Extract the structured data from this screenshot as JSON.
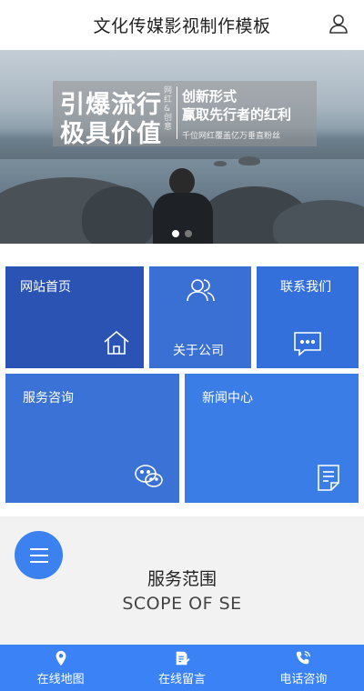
{
  "header": {
    "title": "文化传媒影视制作模板",
    "user_icon": "user-icon"
  },
  "banner": {
    "slogan_line1": "引爆流行",
    "slogan_line2": "极具价值",
    "slogan_vertical": "网红&创意",
    "right_line1": "创新形式",
    "right_line2": "赢取先行者的红利",
    "right_small": "千位网红覆盖亿万垂直粉丝",
    "slide_count": 2,
    "active_slide": 1
  },
  "tiles": [
    {
      "label": "网站首页",
      "icon": "home-icon"
    },
    {
      "label": "关于公司",
      "icon": "users-icon"
    },
    {
      "label": "联系我们",
      "icon": "message-icon"
    },
    {
      "label": "服务咨询",
      "icon": "wechat-icon"
    },
    {
      "label": "新闻中心",
      "icon": "news-icon"
    }
  ],
  "services": {
    "title": "服务范围",
    "subtitle": "SCOPE OF SE",
    "menu_icon": "menu-icon"
  },
  "footer": [
    {
      "label": "在线地图",
      "icon": "location-icon"
    },
    {
      "label": "在线留言",
      "icon": "edit-note-icon"
    },
    {
      "label": "电话咨询",
      "icon": "phone-icon"
    }
  ]
}
